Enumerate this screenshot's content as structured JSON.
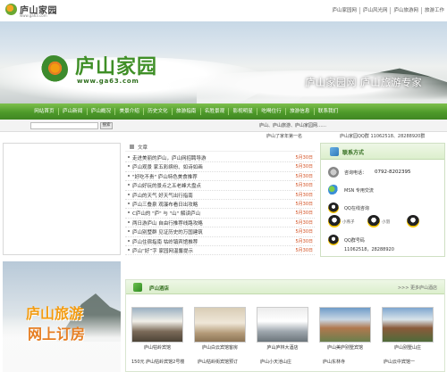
{
  "header": {
    "small_logo_text": "庐山家园",
    "small_logo_url": "www.ga63.com",
    "top_links": [
      "庐山家园网",
      "庐山风光网",
      "庐山旅游网",
      "旅游工作"
    ]
  },
  "banner": {
    "logo_title": "庐山家园",
    "logo_url": "www.ga63.com",
    "slogan": "庐山家园网  庐山旅游专家"
  },
  "nav": {
    "items": [
      "网站首页",
      "庐山新闻",
      "庐山概况",
      "美景介绍",
      "历史文化",
      "旅游指南",
      "名胜景观",
      "影视明星",
      "吃喝住行",
      "旅游信息",
      "联系我们"
    ]
  },
  "subnav": {
    "search_button": "搜索",
    "marquee_text": "庐山、庐山旅游、庐山家园网……"
  },
  "notice": {
    "left": "庐山了家年第一名",
    "right": "庐山家园QQ群  11062518、28288920群"
  },
  "news": {
    "heading": "文章",
    "items": [
      {
        "text": "走进美丽的庐山，庐山网招聘导游",
        "date": "5月30日"
      },
      {
        "text": "庐山观景 家五彩缤纷、如诗如画",
        "date": "5月30日"
      },
      {
        "text": "\"好吃不贵\" 庐山特色美食推荐",
        "date": "5月30日"
      },
      {
        "text": "庐山好玩的景点之五老峰大盘点",
        "date": "5月30日"
      },
      {
        "text": "庐山的天气 好天气出行指南",
        "date": "5月30日"
      },
      {
        "text": "庐山三叠泉 观瀑布看日出攻略",
        "date": "5月30日"
      },
      {
        "text": "C庐山的 \"庐\" 与 \"山\" 解读庐山",
        "date": "5月30日"
      },
      {
        "text": "两日游庐山 自由行推荐线路攻略",
        "date": "5月30日"
      },
      {
        "text": "庐山别墅群 见证历史的万国建筑",
        "date": "5月30日"
      },
      {
        "text": "庐山住宿指南 牯岭镇宾馆推荐",
        "date": "5月30日"
      },
      {
        "text": "庐山“好”字 家园网温馨提示",
        "date": "5月30日"
      }
    ]
  },
  "contact": {
    "heading": "联系方式",
    "phone_label": "咨询电话：",
    "phone_value": "0792-8202395",
    "msn_label": "MSN 专用交流",
    "qq_label": "QQ在线咨询",
    "qq_names": [
      "小燕子",
      "小羽"
    ],
    "qqgroup_label": "QQ群号码",
    "qqgroup_values": "11062518，28288920"
  },
  "promo": {
    "line1": "庐山旅游",
    "line2": "网上订房"
  },
  "hotels": {
    "heading": "庐山酒店",
    "more": ">>> 更多庐山酒店",
    "cards": [
      {
        "caption": "庐山牯岭宾馆"
      },
      {
        "caption": "庐山白云宾馆客房"
      },
      {
        "caption": "庐山庐林大酒店"
      },
      {
        "caption": "庐山美庐别墅宾馆"
      },
      {
        "caption": "庐山别墅山庄"
      }
    ],
    "list": [
      "150元 庐山牯岭宾馆2号楼",
      "庐山牯岭街宾馆预订",
      "庐山小天池山庄",
      "庐山东林寺",
      "庐山云中宾馆一"
    ]
  }
}
